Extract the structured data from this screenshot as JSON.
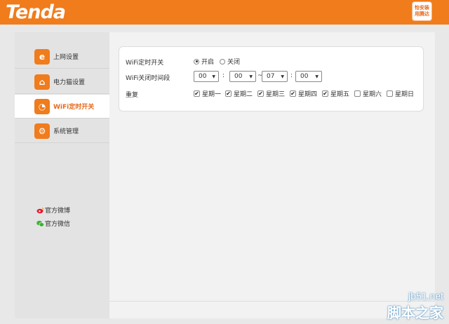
{
  "header": {
    "logo": "Tenda",
    "badge_line1": "怡安装",
    "badge_line2": "用腾达"
  },
  "sidebar": {
    "items": [
      {
        "label": "上网设置",
        "icon": "e"
      },
      {
        "label": "电力猫设置",
        "icon": "⌂"
      },
      {
        "label": "WiFi定时开关",
        "icon": "◔"
      },
      {
        "label": "系统管理",
        "icon": "⚙"
      }
    ],
    "social": [
      {
        "label": "官方微博"
      },
      {
        "label": "官方微信"
      }
    ]
  },
  "form": {
    "switch_label": "WiFi定时开关",
    "switch_on": "开启",
    "switch_off": "关闭",
    "period_label": "WiFi关闭时间段",
    "start_hour": "00",
    "start_min": "00",
    "end_hour": "07",
    "end_min": "00",
    "colon": ":",
    "tilde": "~",
    "repeat_label": "重复",
    "days": [
      {
        "label": "星期一",
        "checked": true
      },
      {
        "label": "星期二",
        "checked": true
      },
      {
        "label": "星期三",
        "checked": true
      },
      {
        "label": "星期四",
        "checked": true
      },
      {
        "label": "星期五",
        "checked": true
      },
      {
        "label": "星期六",
        "checked": false
      },
      {
        "label": "星期日",
        "checked": false
      }
    ]
  },
  "watermark": {
    "line1": "jb51.net",
    "line2": "脚本之家"
  },
  "colors": {
    "brand": "#f07c1c"
  }
}
